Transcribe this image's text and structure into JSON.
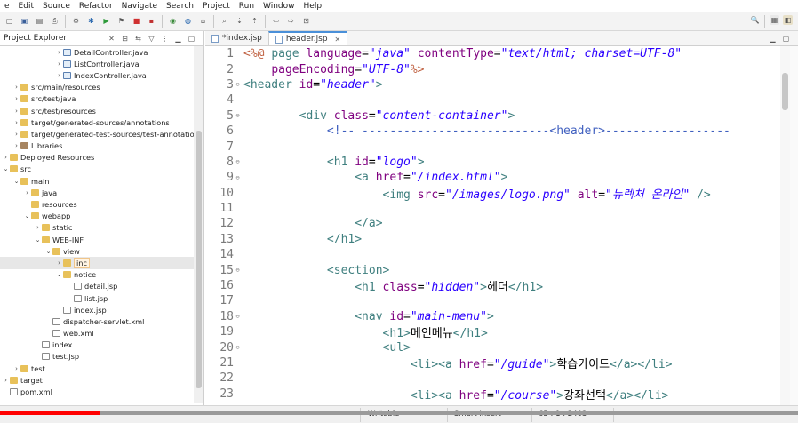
{
  "menubar": {
    "items": [
      "e",
      "Edit",
      "Source",
      "Refactor",
      "Navigate",
      "Search",
      "Project",
      "Run",
      "Window",
      "Help"
    ]
  },
  "toolbar": {
    "icons": [
      "new-icon",
      "save-icon",
      "save-all-icon",
      "print-icon",
      "build-icon",
      "debug-icon",
      "run-icon",
      "run-external-icon",
      "stop-icon",
      "terminate-icon",
      "server-icon",
      "web-icon",
      "open-type-icon",
      "search-icon",
      "next-annotation-icon",
      "prev-annotation-icon",
      "back-icon",
      "forward-icon",
      "pin-icon"
    ]
  },
  "explorer": {
    "title": "Project Explorer",
    "items": [
      {
        "label": "DetailController.java",
        "twisty": "›",
        "icon": "java",
        "indent": 5
      },
      {
        "label": "ListController.java",
        "twisty": "›",
        "icon": "java",
        "indent": 5
      },
      {
        "label": "IndexController.java",
        "twisty": "›",
        "icon": "java",
        "indent": 5
      },
      {
        "label": "src/main/resources",
        "twisty": "›",
        "icon": "folder",
        "indent": 1
      },
      {
        "label": "src/test/java",
        "twisty": "›",
        "icon": "folder",
        "indent": 1
      },
      {
        "label": "src/test/resources",
        "twisty": "›",
        "icon": "folder",
        "indent": 1
      },
      {
        "label": "target/generated-sources/annotations",
        "twisty": "›",
        "icon": "folder",
        "indent": 1
      },
      {
        "label": "target/generated-test-sources/test-annotations",
        "twisty": "›",
        "icon": "folder",
        "indent": 1
      },
      {
        "label": "Libraries",
        "twisty": "›",
        "icon": "lib",
        "indent": 1
      },
      {
        "label": "Deployed Resources",
        "twisty": "›",
        "icon": "folder",
        "indent": 0
      },
      {
        "label": "src",
        "twisty": "⌄",
        "icon": "folder",
        "indent": 0
      },
      {
        "label": "main",
        "twisty": "⌄",
        "icon": "folder",
        "indent": 1
      },
      {
        "label": "java",
        "twisty": "›",
        "icon": "folder",
        "indent": 2
      },
      {
        "label": "resources",
        "twisty": "",
        "icon": "folder",
        "indent": 2
      },
      {
        "label": "webapp",
        "twisty": "⌄",
        "icon": "folder",
        "indent": 2
      },
      {
        "label": "static",
        "twisty": "›",
        "icon": "folder",
        "indent": 3
      },
      {
        "label": "WEB-INF",
        "twisty": "⌄",
        "icon": "folder",
        "indent": 3
      },
      {
        "label": "view",
        "twisty": "⌄",
        "icon": "folder",
        "indent": 4
      },
      {
        "label": "inc",
        "twisty": "›",
        "icon": "folder",
        "indent": 5,
        "selected": true
      },
      {
        "label": "notice",
        "twisty": "⌄",
        "icon": "folder",
        "indent": 5
      },
      {
        "label": "detail.jsp",
        "twisty": "",
        "icon": "file",
        "indent": 6
      },
      {
        "label": "list.jsp",
        "twisty": "",
        "icon": "file",
        "indent": 6
      },
      {
        "label": "index.jsp",
        "twisty": "",
        "icon": "file",
        "indent": 5
      },
      {
        "label": "dispatcher-servlet.xml",
        "twisty": "",
        "icon": "file",
        "indent": 4
      },
      {
        "label": "web.xml",
        "twisty": "",
        "icon": "file",
        "indent": 4
      },
      {
        "label": "index",
        "twisty": "",
        "icon": "file",
        "indent": 3
      },
      {
        "label": "test.jsp",
        "twisty": "",
        "icon": "file",
        "indent": 3
      },
      {
        "label": "test",
        "twisty": "›",
        "icon": "folder",
        "indent": 1
      },
      {
        "label": "target",
        "twisty": "›",
        "icon": "folder",
        "indent": 0
      },
      {
        "label": "pom.xml",
        "twisty": "",
        "icon": "file",
        "indent": 0
      }
    ]
  },
  "editor": {
    "tabs": [
      {
        "label": "*index.jsp",
        "active": false
      },
      {
        "label": "header.jsp",
        "active": true
      }
    ],
    "lines": [
      {
        "n": "1",
        "fold": "",
        "html": "<span class='d'>&lt;%@</span> <span class='k'>page</span> <span class='a'>language</span>=<span class='s'>\"java\"</span> <span class='a'>contentType</span>=<span class='s'>\"text/html; charset=UTF-8\"</span>"
      },
      {
        "n": "2",
        "fold": "",
        "html": "    <span class='a'>pageEncoding</span>=<span class='s'>\"UTF-8\"</span><span class='d'>%&gt;</span>"
      },
      {
        "n": "3",
        "fold": "⊖",
        "html": "<span class='k'>&lt;header</span> <span class='a'>id</span>=<span class='s'>\"header\"</span><span class='k'>&gt;</span>"
      },
      {
        "n": "4",
        "fold": "",
        "html": ""
      },
      {
        "n": "5",
        "fold": "⊖",
        "html": "        <span class='k'>&lt;div</span> <span class='a'>class</span>=<span class='s'>\"content-container\"</span><span class='k'>&gt;</span>"
      },
      {
        "n": "6",
        "fold": "",
        "html": "            <span class='c'>&lt;!-- ---------------------------&lt;header&gt;------------------</span>"
      },
      {
        "n": "7",
        "fold": "",
        "html": ""
      },
      {
        "n": "8",
        "fold": "⊖",
        "html": "            <span class='k'>&lt;h1</span> <span class='a'>id</span>=<span class='s'>\"logo\"</span><span class='k'>&gt;</span>"
      },
      {
        "n": "9",
        "fold": "⊖",
        "html": "                <span class='k'>&lt;a</span> <span class='a'>href</span>=<span class='s'>\"/index.html\"</span><span class='k'>&gt;</span>"
      },
      {
        "n": "10",
        "fold": "",
        "html": "                    <span class='k'>&lt;img</span> <span class='a'>src</span>=<span class='s'>\"/images/logo.png\"</span> <span class='a'>alt</span>=<span class='s'>\"뉴렉처 온라인\"</span> <span class='k'>/&gt;</span>"
      },
      {
        "n": "11",
        "fold": "",
        "html": ""
      },
      {
        "n": "12",
        "fold": "",
        "html": "                <span class='k'>&lt;/a&gt;</span>"
      },
      {
        "n": "13",
        "fold": "",
        "html": "            <span class='k'>&lt;/h1&gt;</span>"
      },
      {
        "n": "14",
        "fold": "",
        "html": ""
      },
      {
        "n": "15",
        "fold": "⊖",
        "html": "            <span class='k'>&lt;section&gt;</span>"
      },
      {
        "n": "16",
        "fold": "",
        "html": "                <span class='k'>&lt;h1</span> <span class='a'>class</span>=<span class='s'>\"hidden\"</span><span class='k'>&gt;</span><span class='t'>헤더</span><span class='k'>&lt;/h1&gt;</span>"
      },
      {
        "n": "17",
        "fold": "",
        "html": ""
      },
      {
        "n": "18",
        "fold": "⊖",
        "html": "                <span class='k'>&lt;nav</span> <span class='a'>id</span>=<span class='s'>\"main-menu\"</span><span class='k'>&gt;</span>"
      },
      {
        "n": "19",
        "fold": "",
        "html": "                    <span class='k'>&lt;h1&gt;</span><span class='t'>메인메뉴</span><span class='k'>&lt;/h1&gt;</span>"
      },
      {
        "n": "20",
        "fold": "⊖",
        "html": "                    <span class='k'>&lt;ul&gt;</span>"
      },
      {
        "n": "21",
        "fold": "",
        "html": "                        <span class='k'>&lt;li&gt;&lt;a</span> <span class='a'>href</span>=<span class='s'>\"/guide\"</span><span class='k'>&gt;</span><span class='t'>학습가이드</span><span class='k'>&lt;/a&gt;&lt;/li&gt;</span>"
      },
      {
        "n": "22",
        "fold": "",
        "html": ""
      },
      {
        "n": "23",
        "fold": "",
        "html": "                        <span class='k'>&lt;li&gt;&lt;a</span> <span class='a'>href</span>=<span class='s'>\"/course\"</span><span class='k'>&gt;</span><span class='t'>강좌선택</span><span class='k'>&lt;/a&gt;&lt;/li&gt;</span>"
      }
    ]
  },
  "status": {
    "writable": "Writable",
    "insert": "Smart Insert",
    "position": "65 : 1 : 2403"
  },
  "video_progress": 0.125
}
